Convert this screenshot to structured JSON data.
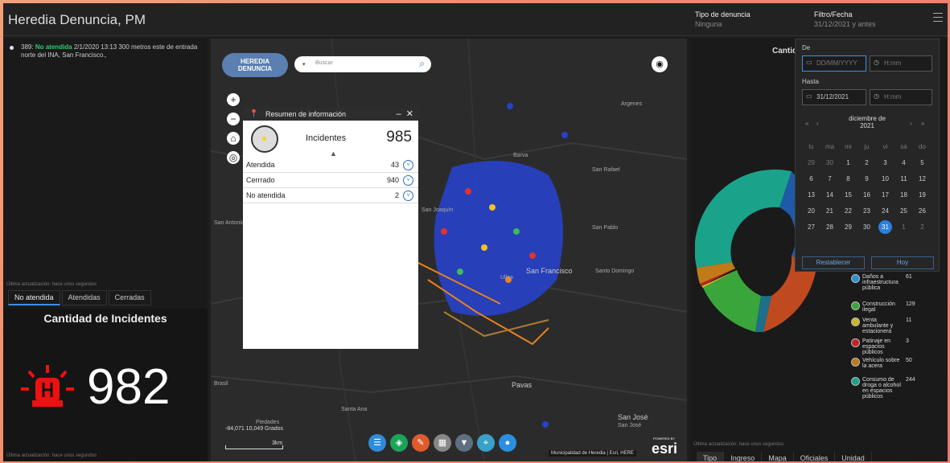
{
  "header": {
    "title": "Heredia Denuncia, PM",
    "tipo_label": "Tipo de denuncia",
    "tipo_value": "Ninguna",
    "filtro_label": "Filtro/Fecha",
    "filtro_value": "31/12/2021 y antes"
  },
  "left_panel": {
    "list_item": {
      "id": "389:",
      "status": "No atendida",
      "text": "2/1/2020 13:13 300 metros este de entrada norte del INA, San Francisco.,"
    },
    "last_update": "Última actualización: hace unos segundos",
    "tabs": [
      "No atendida",
      "Atendidas",
      "Cerradas"
    ],
    "active_tab": 0
  },
  "count_panel": {
    "title": "Cantidad de Incidentes",
    "value": "982",
    "last_update": "Última actualización: hace unos segundos"
  },
  "map": {
    "logo_line1": "HEREDIA",
    "logo_line2": "DENUNCIA",
    "search_placeholder": "Buscar",
    "places": [
      "Barva",
      "Heredia",
      "San Rafael",
      "San Joaquín",
      "San Pablo",
      "San Antonio",
      "San Francisco",
      "Santo Domingo",
      "Ulloa",
      "Pavas",
      "Santa Ana",
      "San José",
      "San José",
      "Piedades",
      "Brasil",
      "Argenes"
    ],
    "coords": "-84,071 10,049 Grados",
    "scale_label": "3km",
    "attribution": "Municipalidad de Heredia | Esri, HERE",
    "esri_tag": "POWERED BY",
    "esri": "esri",
    "toolbar_icons": [
      "list-icon",
      "layers-icon",
      "draw-icon",
      "grid-icon",
      "filter-icon",
      "location-icon",
      "pin-icon"
    ],
    "toolbar_colors": [
      "#2f8ad8",
      "#1aa35a",
      "#e05a2b",
      "#888888",
      "#5f6f7f",
      "#3aa0c8",
      "#2a8fe0"
    ]
  },
  "popup": {
    "title": "Resumen de información",
    "incidentes_label": "Incidentes",
    "incidentes_total": "985",
    "rows": [
      {
        "name": "Atendida",
        "value": "43"
      },
      {
        "name": "Cerrrado",
        "value": "940"
      },
      {
        "name": "No atendida",
        "value": "2"
      }
    ]
  },
  "right_panel": {
    "chart_title": "Cantida",
    "legend": [
      {
        "name": "Daños a infraestructura pública",
        "value": "61",
        "color": "#2f8fd0"
      },
      {
        "name": "Construcción ilegal",
        "value": "129",
        "color": "#3aa53a"
      },
      {
        "name": "Venta ambulante y estacionera",
        "value": "11",
        "color": "#c8b52a"
      },
      {
        "name": "Patinaje en espacios públicos",
        "value": "3",
        "color": "#c02525"
      },
      {
        "name": "Vehículo sobre la acera",
        "value": "50",
        "color": "#c07a1a"
      },
      {
        "name": "Consumo de droga o alcohol en espacios públicos",
        "value": "244",
        "color": "#1aa38a"
      }
    ],
    "last_update": "Última actualización: hace unos segundos",
    "tabs": [
      "Tipo",
      "Ingreso",
      "Mapa",
      "Oficiales",
      "Unidad"
    ],
    "active_tab": 0
  },
  "datepicker": {
    "de_label": "De",
    "de_placeholder": "DD/MM/YYYY",
    "time_placeholder": "H:mm",
    "hasta_label": "Hasta",
    "hasta_value": "31/12/2021",
    "month": "diciembre de",
    "year": "2021",
    "nav_prev_year": "«",
    "nav_prev": "‹",
    "nav_next": "›",
    "nav_next_year": "»",
    "weekdays": [
      "lu",
      "ma",
      "mi",
      "ju",
      "vi",
      "sá",
      "do"
    ],
    "weeks": [
      [
        "29",
        "30",
        "1",
        "2",
        "3",
        "4",
        "5"
      ],
      [
        "6",
        "7",
        "8",
        "9",
        "10",
        "11",
        "12"
      ],
      [
        "13",
        "14",
        "15",
        "16",
        "17",
        "18",
        "19"
      ],
      [
        "20",
        "21",
        "22",
        "23",
        "24",
        "25",
        "26"
      ],
      [
        "27",
        "28",
        "29",
        "30",
        "31",
        "1",
        "2"
      ]
    ],
    "selected_day": "31",
    "reset_label": "Restablecer",
    "today_label": "Hoy"
  }
}
